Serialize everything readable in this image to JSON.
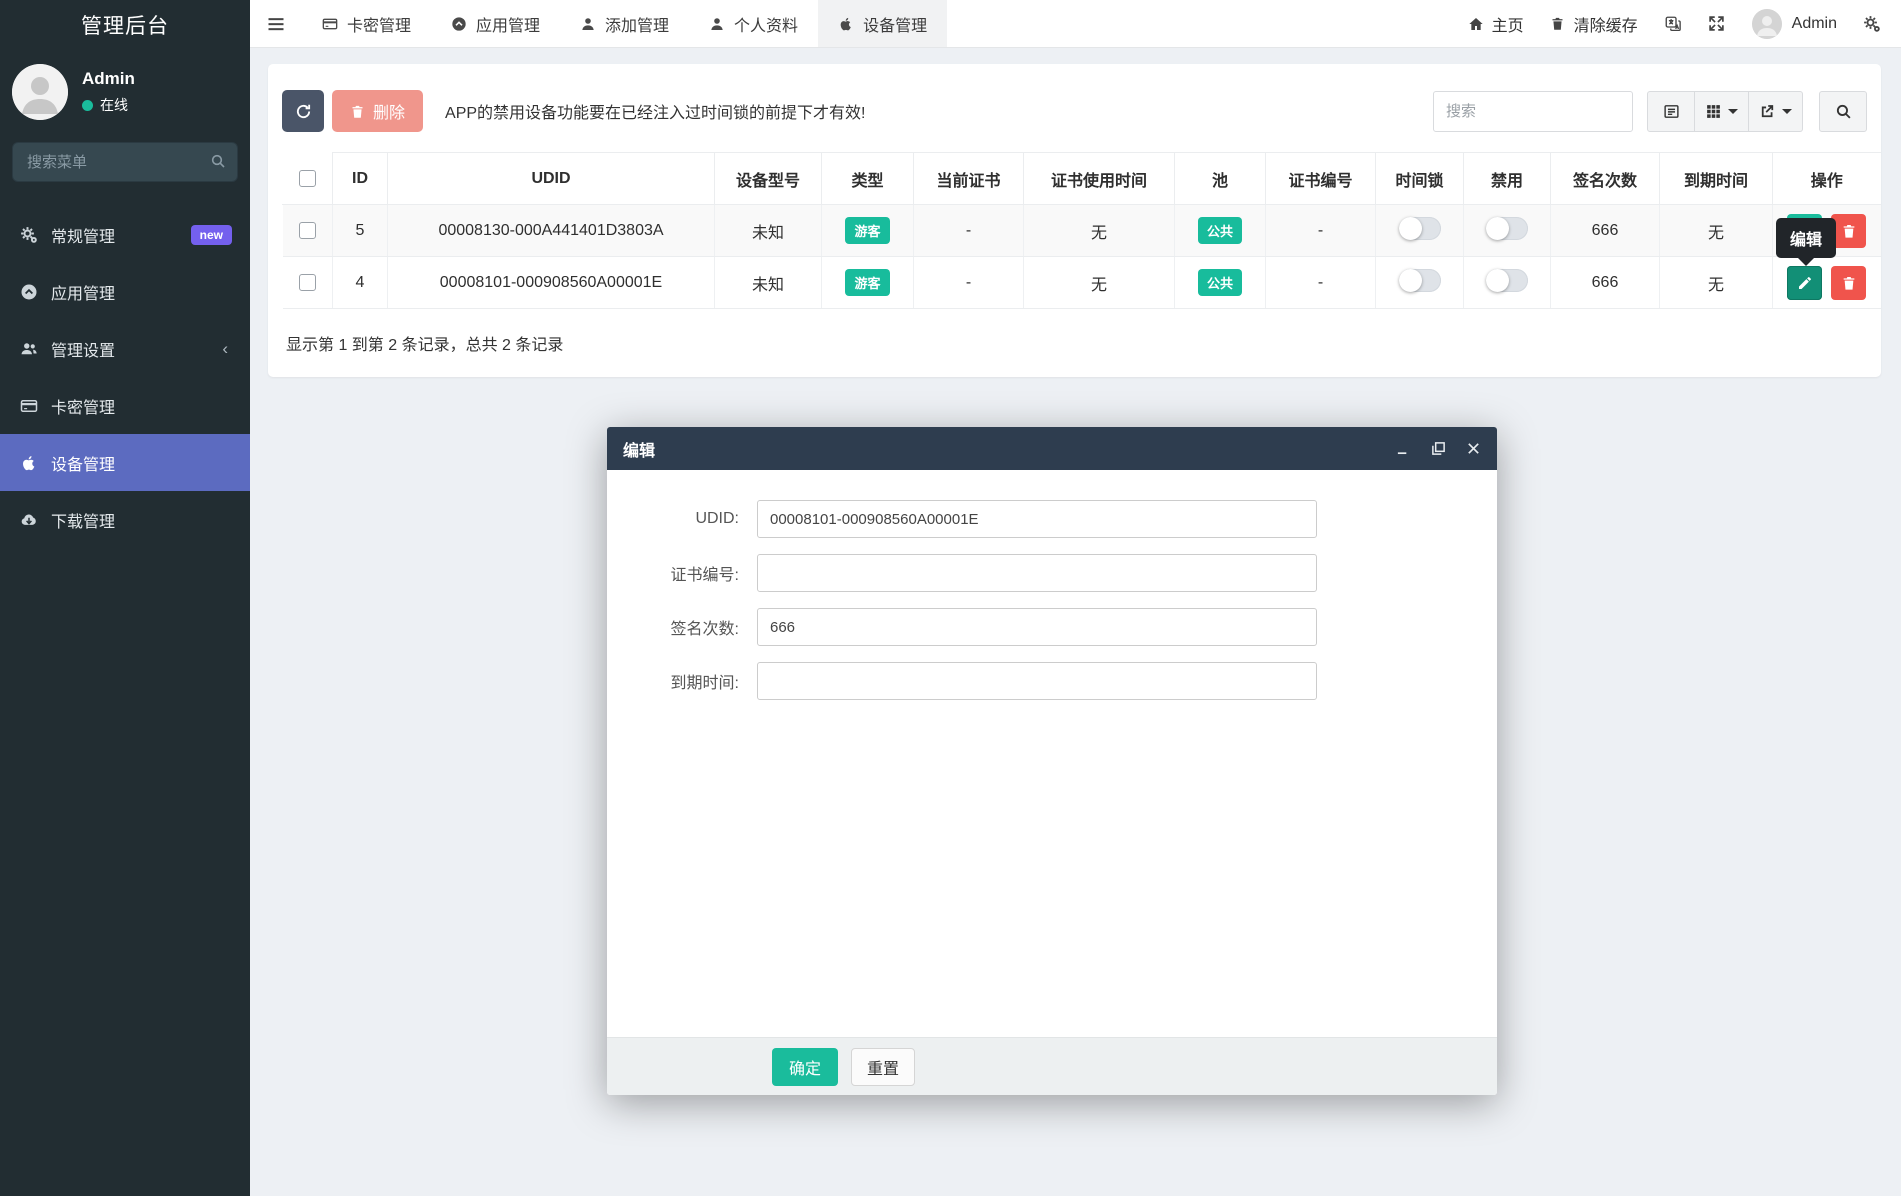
{
  "app_title": "管理后台",
  "sidebar": {
    "user": {
      "name": "Admin",
      "status": "在线"
    },
    "search_placeholder": "搜索菜单",
    "items": [
      {
        "label": "常规管理",
        "icon": "gears-icon",
        "badge": "new"
      },
      {
        "label": "应用管理",
        "icon": "circle-arrow-icon"
      },
      {
        "label": "管理设置",
        "icon": "users-icon",
        "chevron": "‹"
      },
      {
        "label": "卡密管理",
        "icon": "card-icon"
      },
      {
        "label": "设备管理",
        "icon": "apple-icon",
        "active": true
      },
      {
        "label": "下载管理",
        "icon": "cloud-download-icon"
      }
    ]
  },
  "topnav": {
    "tabs": [
      {
        "label": "卡密管理",
        "icon": "card-icon"
      },
      {
        "label": "应用管理",
        "icon": "circle-arrow-icon"
      },
      {
        "label": "添加管理",
        "icon": "user-icon"
      },
      {
        "label": "个人资料",
        "icon": "user-icon"
      },
      {
        "label": "设备管理",
        "icon": "apple-icon",
        "active": true
      }
    ],
    "right": {
      "home": "主页",
      "clear_cache": "清除缓存",
      "username": "Admin"
    }
  },
  "toolbar": {
    "delete_label": "删除",
    "notice": "APP的禁用设备功能要在已经注入过时间锁的前提下才有效!",
    "search_placeholder": "搜索"
  },
  "table": {
    "columns": [
      "ID",
      "UDID",
      "设备型号",
      "类型",
      "当前证书",
      "证书使用时间",
      "池",
      "证书编号",
      "时间锁",
      "禁用",
      "签名次数",
      "到期时间",
      "操作"
    ],
    "rows": [
      {
        "id": "5",
        "udid": "00008130-000A441401D3803A",
        "model": "未知",
        "type": "游客",
        "cert": "-",
        "cert_time": "无",
        "pool": "公共",
        "cert_no": "-",
        "sign_count": "666",
        "expire": "无"
      },
      {
        "id": "4",
        "udid": "00008101-000908560A00001E",
        "model": "未知",
        "type": "游客",
        "cert": "-",
        "cert_time": "无",
        "pool": "公共",
        "cert_no": "-",
        "sign_count": "666",
        "expire": "无"
      }
    ],
    "summary": "显示第 1 到第 2 条记录，总共 2 条记录"
  },
  "tooltip_label": "编辑",
  "modal": {
    "title": "编辑",
    "fields": [
      {
        "label": "UDID:",
        "value": "00008101-000908560A00001E"
      },
      {
        "label": "证书编号:",
        "value": ""
      },
      {
        "label": "签名次数:",
        "value": "666"
      },
      {
        "label": "到期时间:",
        "value": ""
      }
    ],
    "ok_label": "确定",
    "reset_label": "重置"
  },
  "colors": {
    "sidebar_bg": "#222d32",
    "sidebar_active": "#5c6bc0",
    "badge_new": "#7460ee",
    "accent_green": "#1abc9c",
    "badge_green": "#18bc9c",
    "danger_red": "#f0544c",
    "delete_salmon": "#f0968c",
    "refresh_dark": "#4a5568",
    "modal_header": "#2e3d4f",
    "content_bg": "#edf0f4"
  }
}
